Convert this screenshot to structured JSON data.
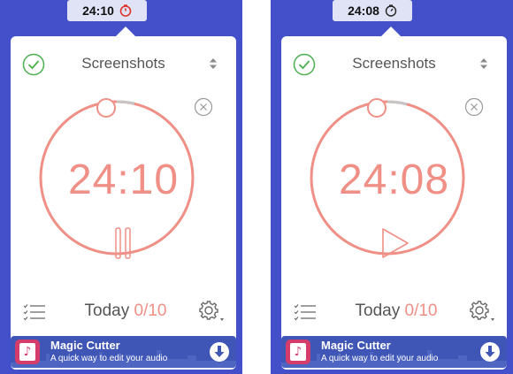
{
  "panels": [
    {
      "menubar_time": "24:10",
      "project": "Screenshots",
      "timer": "24:10",
      "state": "running",
      "control_icon": "pause-icon",
      "today_label": "Today",
      "today_count": "0/10",
      "ad": {
        "title": "Magic Cutter",
        "subtitle": "A quick way to edit your audio"
      }
    },
    {
      "menubar_time": "24:08",
      "project": "Screenshots",
      "timer": "24:08",
      "state": "paused",
      "control_icon": "play-icon",
      "today_label": "Today",
      "today_count": "0/10",
      "ad": {
        "title": "Magic Cutter",
        "subtitle": "A quick way to edit your audio"
      }
    }
  ],
  "colors": {
    "accent": "#ef8f86",
    "check": "#4caf50",
    "background": "#4350c9",
    "ad_banner": "#3f56b7",
    "running_indicator": "#e0332a"
  }
}
